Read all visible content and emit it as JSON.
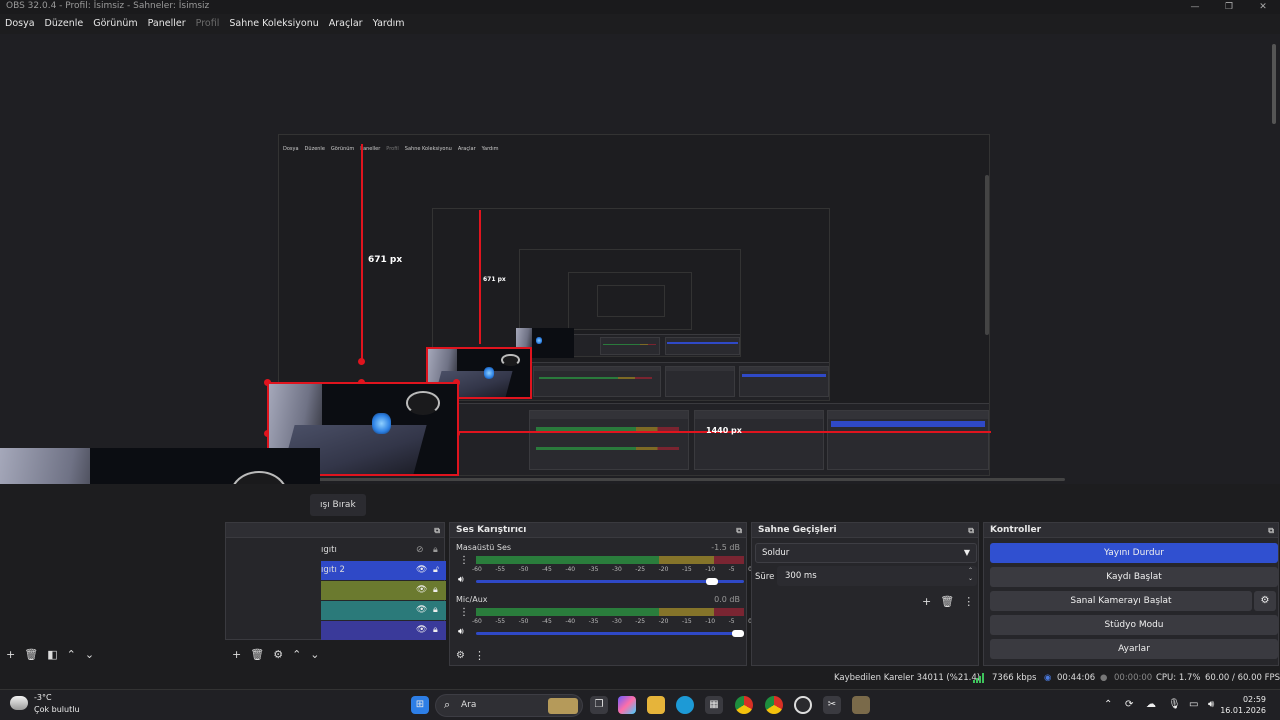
{
  "window": {
    "title": "OBS 32.0.4 - Profil: İsimsiz - Sahneler: İsimsiz",
    "controls": [
      "—",
      "❐",
      "✕"
    ]
  },
  "menu": [
    "Dosya",
    "Düzenle",
    "Görünüm",
    "Paneller",
    "Profil",
    "Sahne Koleksiyonu",
    "Araçlar",
    "Yardım"
  ],
  "preview": {
    "measure_label_vertical": "671 px",
    "measure_label_vertical_inner": "671 px",
    "measure_label_horizontal": "1440 px"
  },
  "scenes_tab_fragment": "ışı Bırak",
  "sources": {
    "rows": [
      {
        "label": "ıgıtı",
        "selected": false,
        "color": ""
      },
      {
        "label": "ıgıtı 2",
        "selected": true,
        "color": "#2f49c7"
      },
      {
        "label": "",
        "selected": false,
        "color": "#6b7a2f"
      },
      {
        "label": "",
        "selected": false,
        "color": "#2b7a7a"
      },
      {
        "label": "",
        "selected": false,
        "color": "#3a3a9a"
      }
    ]
  },
  "mixer": {
    "title": "Ses Karıştırıcı",
    "channels": [
      {
        "name": "Masaüstü Ses",
        "db": "-1.5 dB",
        "volume": 0.9
      },
      {
        "name": "Mic/Aux",
        "db": "0.0 dB",
        "volume": 1.0
      }
    ],
    "ticks": [
      "-60",
      "-55",
      "-50",
      "-45",
      "-40",
      "-35",
      "-30",
      "-25",
      "-20",
      "-15",
      "-10",
      "-5",
      "0"
    ]
  },
  "transitions": {
    "title": "Sahne Geçişleri",
    "selected": "Soldur",
    "duration_label": "Süre",
    "duration_value": "300 ms"
  },
  "controls": {
    "title": "Kontroller",
    "buttons": [
      "Yayını Durdur",
      "Kaydı Başlat",
      "Sanal Kamerayı Başlat",
      "Stüdyo Modu",
      "Ayarlar"
    ]
  },
  "status": {
    "dropped": "Kaybedilen Kareler 34011 (%21.4)",
    "bitrate": "7366 kbps",
    "stream_time": "00:44:06",
    "rec_time": "00:00:00",
    "cpu": "CPU: 1.7%",
    "fps": "60.00 / 60.00 FPS"
  },
  "taskbar": {
    "temp": "-3°C",
    "condition": "Çok bulutlu",
    "search": "Ara",
    "time": "02:59",
    "date": "16.01.2026"
  },
  "colors": {
    "accent_blue": "#3050d0",
    "measure_red": "#e0141e"
  }
}
